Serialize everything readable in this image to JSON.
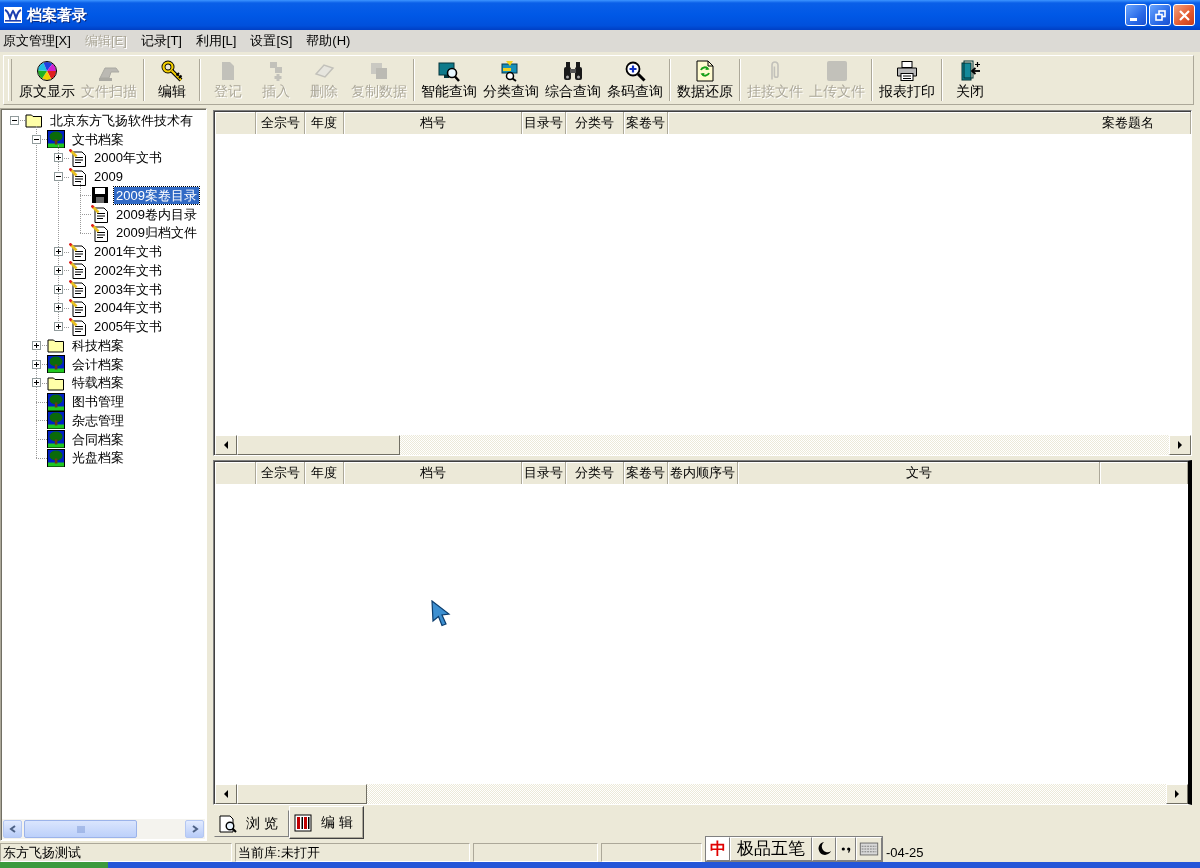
{
  "window": {
    "title": "档案著录"
  },
  "menu": [
    {
      "label": "原文管理[X]",
      "disabled": false
    },
    {
      "label": "编辑[E]",
      "disabled": true
    },
    {
      "label": "记录[T]",
      "disabled": false
    },
    {
      "label": "利用[L]",
      "disabled": false
    },
    {
      "label": "设置[S]",
      "disabled": false
    },
    {
      "label": "帮助(H)",
      "disabled": false
    }
  ],
  "toolbar": {
    "groups": [
      [
        {
          "label": "原文显示",
          "disabled": false
        },
        {
          "label": "文件扫描",
          "disabled": true
        }
      ],
      [
        {
          "label": "编辑",
          "disabled": false
        }
      ],
      [
        {
          "label": "登记",
          "disabled": true
        },
        {
          "label": "插入",
          "disabled": true
        },
        {
          "label": "删除",
          "disabled": true
        },
        {
          "label": "复制数据",
          "disabled": true
        }
      ],
      [
        {
          "label": "智能查询",
          "disabled": false
        },
        {
          "label": "分类查询",
          "disabled": false
        },
        {
          "label": "综合查询",
          "disabled": false
        },
        {
          "label": "条码查询",
          "disabled": false
        }
      ],
      [
        {
          "label": "数据还原",
          "disabled": false
        }
      ],
      [
        {
          "label": "挂接文件",
          "disabled": true
        },
        {
          "label": "上传文件",
          "disabled": true
        }
      ],
      [
        {
          "label": "报表打印",
          "disabled": false
        }
      ],
      [
        {
          "label": "关闭",
          "disabled": false
        }
      ]
    ]
  },
  "tree": [
    {
      "label": "北京东方飞扬软件技术有",
      "kind": "folder",
      "expanded": true,
      "selected": false,
      "children": [
        {
          "label": "文书档案",
          "kind": "category",
          "expanded": true,
          "selected": false,
          "children": [
            {
              "label": "2000年文书",
              "kind": "document",
              "expanded": false,
              "selected": false
            },
            {
              "label": "2009",
              "kind": "document",
              "expanded": true,
              "selected": false,
              "children": [
                {
                  "label": "2009案卷目录",
                  "kind": "open_document",
                  "selected": true
                },
                {
                  "label": "2009卷内目录",
                  "kind": "document",
                  "selected": false
                },
                {
                  "label": "2009归档文件",
                  "kind": "document",
                  "selected": false
                }
              ]
            },
            {
              "label": "2001年文书",
              "kind": "document",
              "expanded": false,
              "selected": false
            },
            {
              "label": "2002年文书",
              "kind": "document",
              "expanded": false,
              "selected": false
            },
            {
              "label": "2003年文书",
              "kind": "document",
              "expanded": false,
              "selected": false
            },
            {
              "label": "2004年文书",
              "kind": "document",
              "expanded": false,
              "selected": false
            },
            {
              "label": "2005年文书",
              "kind": "document",
              "expanded": false,
              "selected": false
            }
          ]
        },
        {
          "label": "科技档案",
          "kind": "folder",
          "expanded": false,
          "selected": false
        },
        {
          "label": "会计档案",
          "kind": "category",
          "expanded": false,
          "selected": false
        },
        {
          "label": "特载档案",
          "kind": "folder",
          "expanded": false,
          "selected": false
        },
        {
          "label": "图书管理",
          "kind": "category",
          "selected": false
        },
        {
          "label": "杂志管理",
          "kind": "category",
          "selected": false
        },
        {
          "label": "合同档案",
          "kind": "category",
          "selected": false
        },
        {
          "label": "光盘档案",
          "kind": "category",
          "selected": false
        }
      ]
    }
  ],
  "upper_grid": {
    "columns": [
      "全宗号",
      "年度",
      "档号",
      "目录号",
      "分类号",
      "案卷号",
      "案卷题名"
    ]
  },
  "lower_grid": {
    "columns": [
      "全宗号",
      "年度",
      "档号",
      "目录号",
      "分类号",
      "案卷号",
      "卷内顺序号",
      "文号"
    ]
  },
  "tabs": [
    {
      "label": "浏 览",
      "selected": false
    },
    {
      "label": "编 辑",
      "selected": true
    }
  ],
  "status_bar": {
    "panels": [
      "东方飞扬测试",
      "当前库:未打开"
    ],
    "date": "-04-25"
  },
  "ime_bar": {
    "mode": "中",
    "name": "极品五笔"
  }
}
